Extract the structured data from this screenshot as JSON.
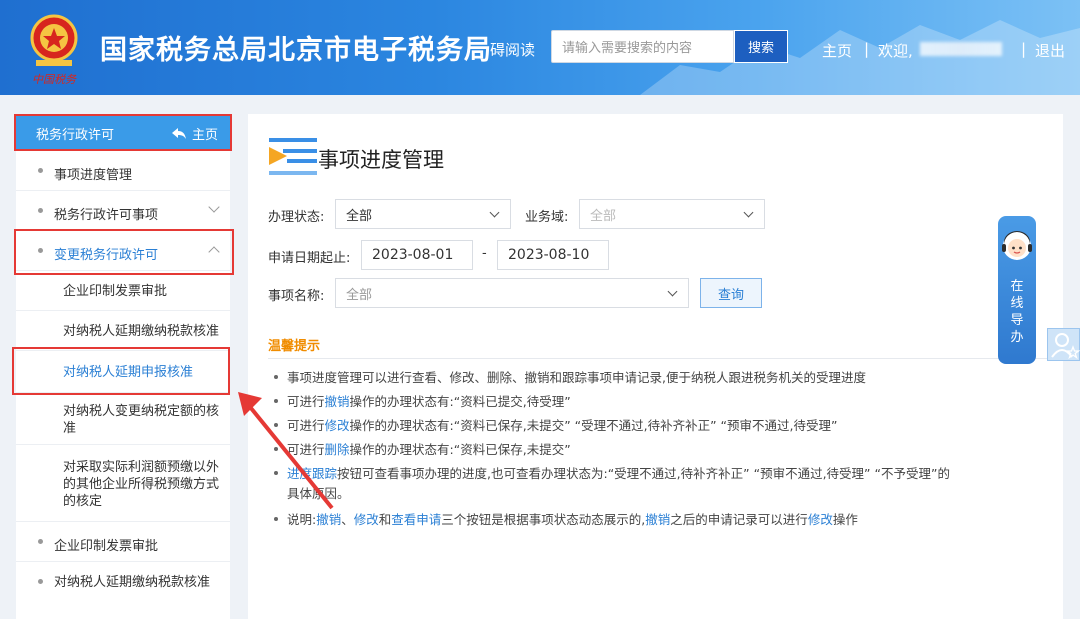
{
  "header": {
    "site_title": "国家税务总局北京市电子税务局",
    "a11y_label": "碍阅读",
    "search_placeholder": "请输入需要搜索的内容",
    "search_button": "搜索",
    "home_link": "主页",
    "separator": "|",
    "welcome": "欢迎,",
    "logout": "退出"
  },
  "sidebar": {
    "header_title": "税务行政许可",
    "header_home": "主页",
    "items": [
      {
        "label": "事项进度管理"
      },
      {
        "label": "税务行政许可事项"
      },
      {
        "label": "变更税务行政许可"
      }
    ],
    "sub_items": [
      {
        "label": "企业印制发票审批"
      },
      {
        "label": "对纳税人延期缴纳税款核准"
      },
      {
        "label": "对纳税人延期申报核准"
      },
      {
        "label": "对纳税人变更纳税定额的核准"
      },
      {
        "label": "对采取实际利润额预缴以外的其他企业所得税预缴方式的核定"
      }
    ],
    "bottom_items": [
      {
        "label": "企业印制发票审批"
      },
      {
        "label": "对纳税人延期缴纳税款核准"
      }
    ]
  },
  "main": {
    "page_title": "事项进度管理",
    "status_label": "办理状态:",
    "status_value": "全部",
    "business_label": "业务域:",
    "business_value": "全部",
    "date_label": "申请日期起止:",
    "date_start": "2023-08-01",
    "date_dash": "-",
    "date_end": "2023-08-10",
    "item_label": "事项名称:",
    "item_value": "全部",
    "query_button": "查询",
    "tips_title": "温馨提示",
    "tips": {
      "t1": "事项进度管理可以进行查看、修改、删除、撤销和跟踪事项申请记录,便于纳税人跟进税务机关的受理进度",
      "t2_pre": "可进行",
      "t2_link": "撤销",
      "t2_post": "操作的办理状态有:“资料已提交,待受理”",
      "t3_pre": "可进行",
      "t3_link": "修改",
      "t3_post": "操作的办理状态有:“资料已保存,未提交”  “受理不通过,待补齐补正”  “预审不通过,待受理”",
      "t4_pre": "可进行",
      "t4_link": "删除",
      "t4_post": "操作的办理状态有:“资料已保存,未提交”",
      "t5_link": "进度跟踪",
      "t5_post": "按钮可查看事项办理的进度,也可查看办理状态为:“受理不通过,待补齐补正” “预审不通过,待受理” “不予受理”的",
      "t5_cont": "具体原因。",
      "t6_pre": "说明:",
      "t6_l1": "撤销",
      "t6_s1": "、",
      "t6_l2": "修改",
      "t6_s2": "和",
      "t6_l3": "查看申请",
      "t6_s3": "三个按钮是根据事项状态动态展示的,",
      "t6_l4": "撤销",
      "t6_s4": "之后的申请记录可以进行",
      "t6_l5": "修改",
      "t6_s5": "操作"
    }
  },
  "guide": {
    "text": "在线导办"
  },
  "colors": {
    "header_blue": "#1f6fd0",
    "accent_blue": "#2a7fd4",
    "sidebar_head": "#3a9be8",
    "annotation_red": "#e53935",
    "tips_orange": "#f08c00"
  }
}
